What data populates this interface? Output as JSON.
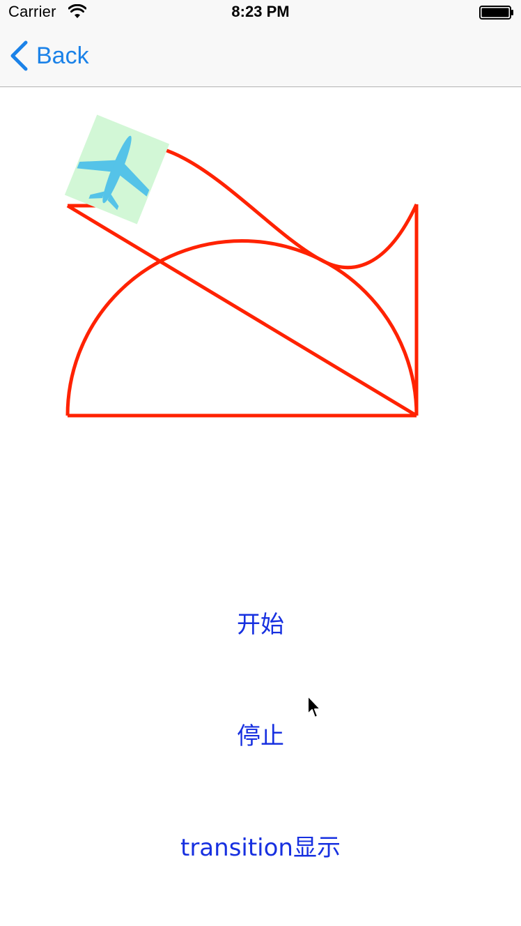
{
  "status_bar": {
    "carrier": "Carrier",
    "time": "8:23 PM",
    "wifi_icon": "wifi-icon",
    "battery_icon": "battery-icon"
  },
  "nav_bar": {
    "back_label": "Back",
    "back_icon": "chevron-left-icon"
  },
  "buttons": {
    "start": "开始",
    "stop": "停止",
    "transition": "transition显示"
  },
  "colors": {
    "path_stroke": "#ff2200",
    "tint": "#1b82e8",
    "button_text": "#1730e0",
    "plane_fill": "#55c3e8",
    "plane_box": "#d2f7d6"
  }
}
